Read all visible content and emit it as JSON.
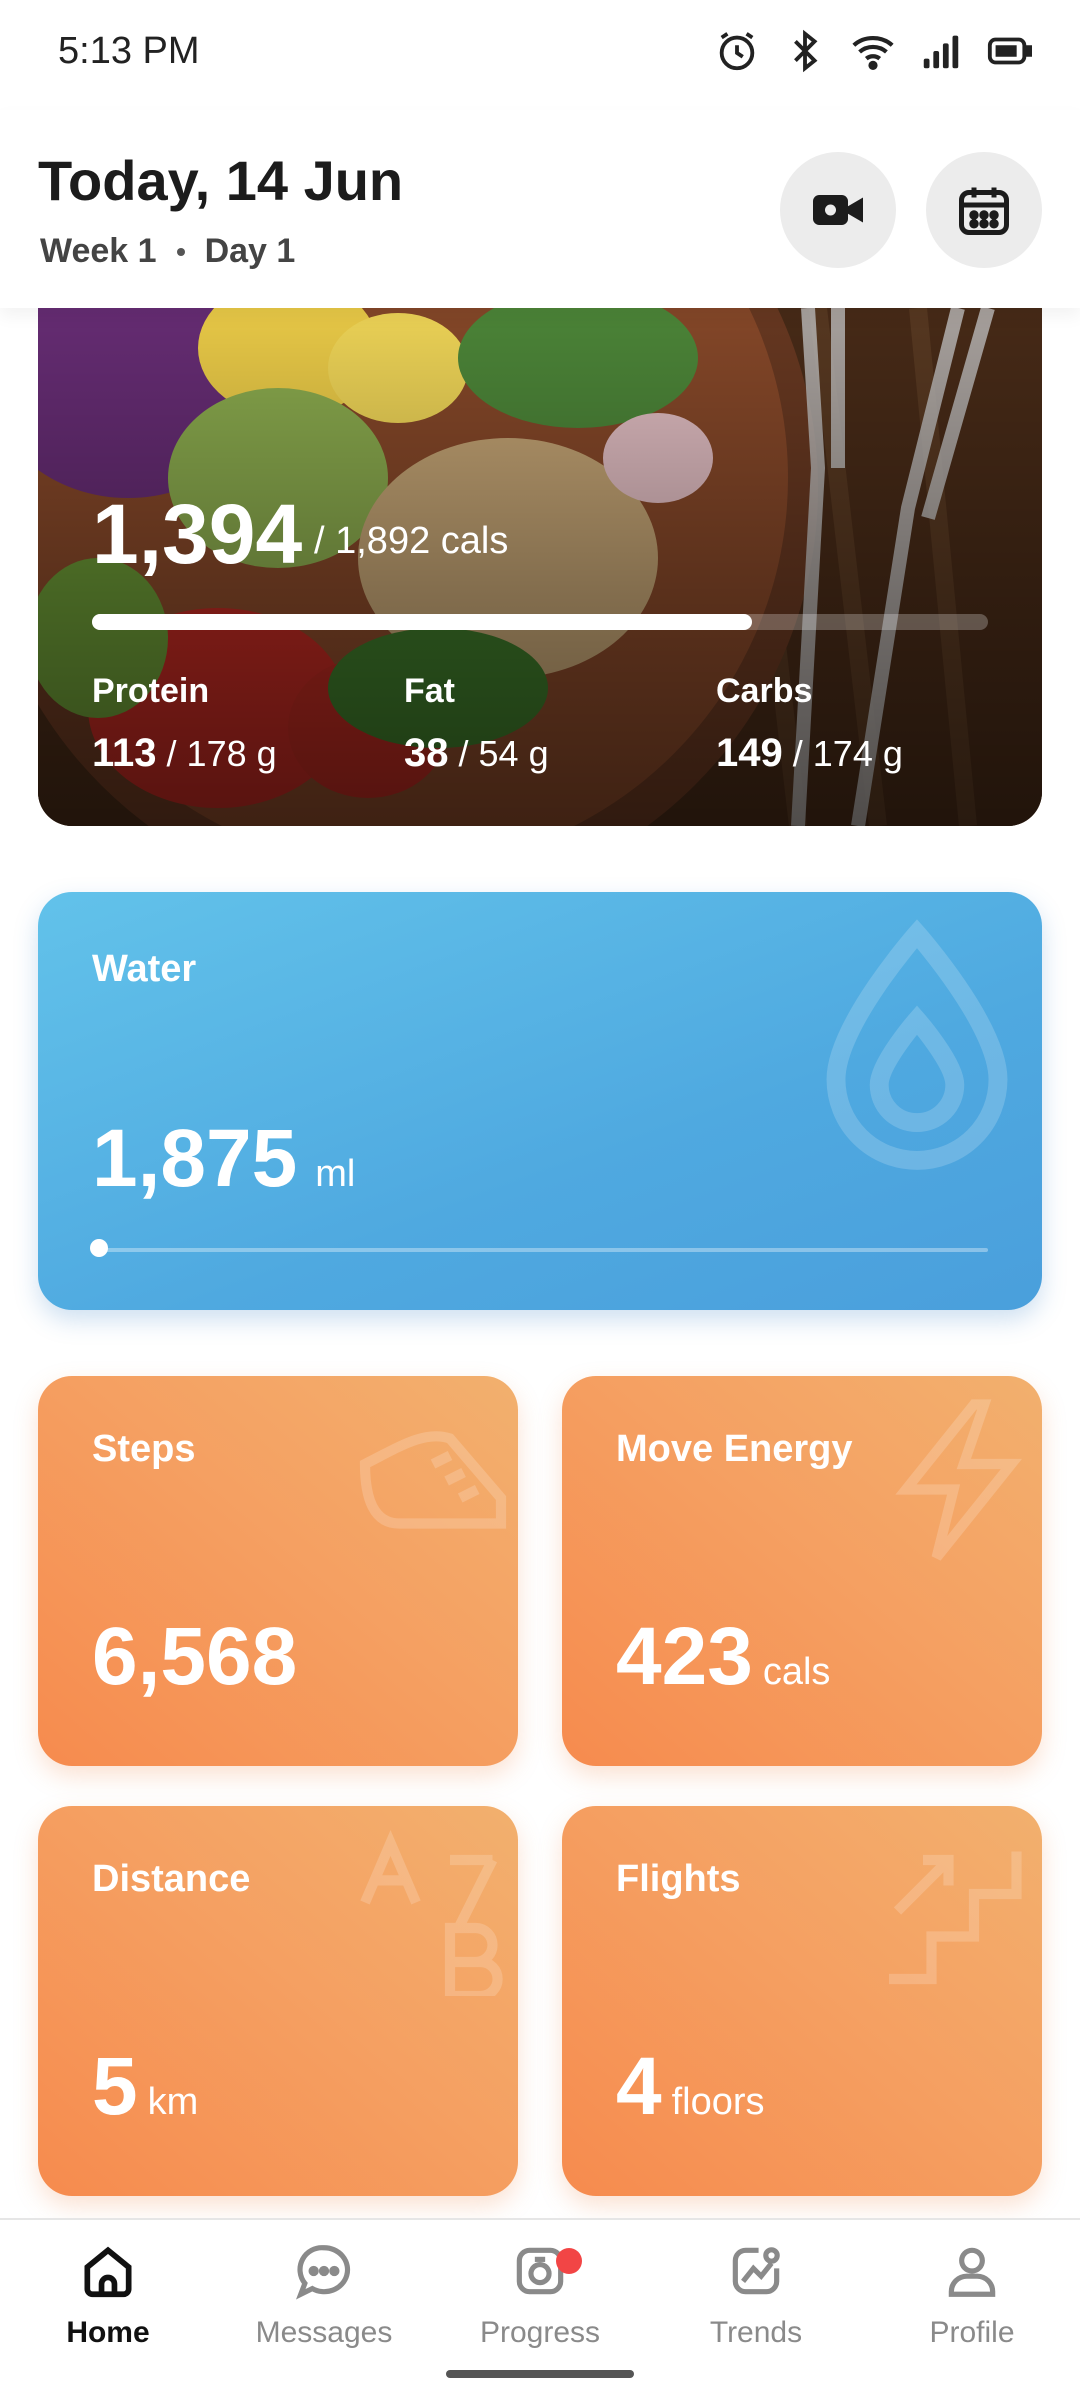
{
  "status_bar": {
    "time": "5:13 PM"
  },
  "header": {
    "title": "Today, 14 Jun",
    "week": "Week 1",
    "day": "Day 1"
  },
  "calories": {
    "consumed": "1,394",
    "goal_text": "/ 1,892 cals",
    "progress": 0.737,
    "macros": [
      {
        "label": "Protein",
        "value": "113",
        "goal": "/ 178 g"
      },
      {
        "label": "Fat",
        "value": "38",
        "goal": "/ 54 g"
      },
      {
        "label": "Carbs",
        "value": "149",
        "goal": "/ 174 g"
      }
    ]
  },
  "water": {
    "label": "Water",
    "value": "1,875",
    "unit": "ml",
    "progress": 0.0
  },
  "stats": {
    "steps": {
      "label": "Steps",
      "value": "6,568",
      "unit": ""
    },
    "move_energy": {
      "label": "Move Energy",
      "value": "423",
      "unit": "cals"
    },
    "distance": {
      "label": "Distance",
      "value": "5",
      "unit": "km"
    },
    "flights": {
      "label": "Flights",
      "value": "4",
      "unit": "floors"
    }
  },
  "nav": {
    "items": [
      {
        "label": "Home",
        "icon": "home-icon",
        "active": true
      },
      {
        "label": "Messages",
        "icon": "chat-icon",
        "active": false
      },
      {
        "label": "Progress",
        "icon": "camera-icon",
        "active": false
      },
      {
        "label": "Trends",
        "icon": "trends-icon",
        "active": false
      },
      {
        "label": "Profile",
        "icon": "person-icon",
        "active": false
      }
    ]
  },
  "colors": {
    "water_card": "#4fa9e0",
    "stat_card": "#f5a062",
    "badge": "#f24545"
  }
}
